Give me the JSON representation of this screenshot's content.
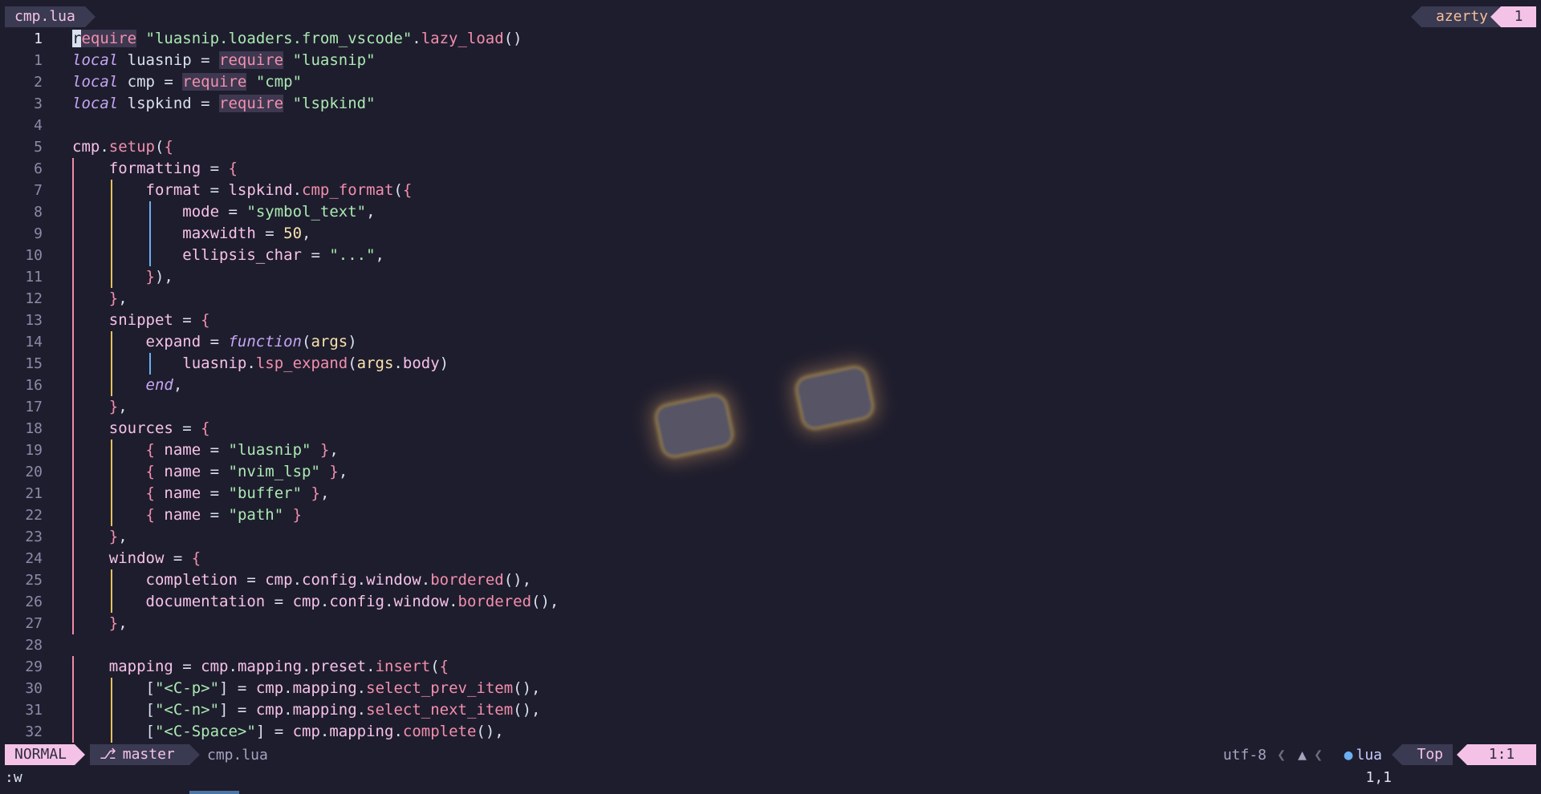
{
  "tabline": {
    "file": "cmp.lua",
    "keyboard_layout": "azerty",
    "tab_count": "1"
  },
  "editor": {
    "lines": [
      {
        "n": "1",
        "guides": 0,
        "current": true,
        "segs": [
          [
            "cursor",
            "r"
          ],
          [
            "req",
            "equire"
          ],
          [
            "op",
            " "
          ],
          [
            "str",
            "\"luasnip.loaders.from_vscode\""
          ],
          [
            "op",
            "."
          ],
          [
            "fn",
            "lazy_load"
          ],
          [
            "op",
            "()"
          ]
        ]
      },
      {
        "n": "1",
        "guides": 0,
        "segs": [
          [
            "kw",
            "local"
          ],
          [
            "id",
            " luasnip = "
          ],
          [
            "req",
            "require"
          ],
          [
            "op",
            " "
          ],
          [
            "str",
            "\"luasnip\""
          ]
        ]
      },
      {
        "n": "2",
        "guides": 0,
        "segs": [
          [
            "kw",
            "local"
          ],
          [
            "id",
            " cmp = "
          ],
          [
            "req",
            "require"
          ],
          [
            "op",
            " "
          ],
          [
            "str",
            "\"cmp\""
          ]
        ]
      },
      {
        "n": "3",
        "guides": 0,
        "segs": [
          [
            "kw",
            "local"
          ],
          [
            "id",
            " lspkind = "
          ],
          [
            "req",
            "require"
          ],
          [
            "op",
            " "
          ],
          [
            "str",
            "\"lspkind\""
          ]
        ]
      },
      {
        "n": "4",
        "guides": 0,
        "segs": []
      },
      {
        "n": "5",
        "guides": 0,
        "segs": [
          [
            "fld",
            "cmp"
          ],
          [
            "op",
            "."
          ],
          [
            "fn",
            "setup"
          ],
          [
            "op",
            "("
          ],
          [
            "br1",
            "{"
          ]
        ]
      },
      {
        "n": "6",
        "guides": 1,
        "segs": [
          [
            "id",
            "    "
          ],
          [
            "fld",
            "formatting"
          ],
          [
            "op",
            " = "
          ],
          [
            "br1",
            "{"
          ]
        ]
      },
      {
        "n": "7",
        "guides": 2,
        "segs": [
          [
            "id",
            "        "
          ],
          [
            "fld",
            "format"
          ],
          [
            "op",
            " = "
          ],
          [
            "fld",
            "lspkind"
          ],
          [
            "op",
            "."
          ],
          [
            "fn",
            "cmp_format"
          ],
          [
            "op",
            "("
          ],
          [
            "br1",
            "{"
          ]
        ]
      },
      {
        "n": "8",
        "guides": 3,
        "segs": [
          [
            "id",
            "            "
          ],
          [
            "fld",
            "mode"
          ],
          [
            "op",
            " = "
          ],
          [
            "str",
            "\"symbol_text\""
          ],
          [
            "op",
            ","
          ]
        ]
      },
      {
        "n": "9",
        "guides": 3,
        "segs": [
          [
            "id",
            "            "
          ],
          [
            "fld",
            "maxwidth"
          ],
          [
            "op",
            " = "
          ],
          [
            "num",
            "50"
          ],
          [
            "op",
            ","
          ]
        ]
      },
      {
        "n": "10",
        "guides": 3,
        "segs": [
          [
            "id",
            "            "
          ],
          [
            "fld",
            "ellipsis_char"
          ],
          [
            "op",
            " = "
          ],
          [
            "str",
            "\"...\""
          ],
          [
            "op",
            ","
          ]
        ]
      },
      {
        "n": "11",
        "guides": 2,
        "segs": [
          [
            "id",
            "        "
          ],
          [
            "br1",
            "}"
          ],
          [
            "op",
            "),"
          ]
        ]
      },
      {
        "n": "12",
        "guides": 1,
        "segs": [
          [
            "id",
            "    "
          ],
          [
            "br1",
            "}"
          ],
          [
            "op",
            ","
          ]
        ]
      },
      {
        "n": "13",
        "guides": 1,
        "segs": [
          [
            "id",
            "    "
          ],
          [
            "fld",
            "snippet"
          ],
          [
            "op",
            " = "
          ],
          [
            "br1",
            "{"
          ]
        ]
      },
      {
        "n": "14",
        "guides": 2,
        "segs": [
          [
            "id",
            "        "
          ],
          [
            "fld",
            "expand"
          ],
          [
            "op",
            " = "
          ],
          [
            "kw",
            "function"
          ],
          [
            "op",
            "("
          ],
          [
            "arg",
            "args"
          ],
          [
            "op",
            ")"
          ]
        ]
      },
      {
        "n": "15",
        "guides": 3,
        "segs": [
          [
            "id",
            "            "
          ],
          [
            "fld",
            "luasnip"
          ],
          [
            "op",
            "."
          ],
          [
            "fn",
            "lsp_expand"
          ],
          [
            "op",
            "("
          ],
          [
            "arg",
            "args"
          ],
          [
            "op",
            "."
          ],
          [
            "fld",
            "body"
          ],
          [
            "op",
            ")"
          ]
        ]
      },
      {
        "n": "16",
        "guides": 2,
        "segs": [
          [
            "id",
            "        "
          ],
          [
            "kw",
            "end"
          ],
          [
            "op",
            ","
          ]
        ]
      },
      {
        "n": "17",
        "guides": 1,
        "segs": [
          [
            "id",
            "    "
          ],
          [
            "br1",
            "}"
          ],
          [
            "op",
            ","
          ]
        ]
      },
      {
        "n": "18",
        "guides": 1,
        "segs": [
          [
            "id",
            "    "
          ],
          [
            "fld",
            "sources"
          ],
          [
            "op",
            " = "
          ],
          [
            "br1",
            "{"
          ]
        ]
      },
      {
        "n": "19",
        "guides": 2,
        "segs": [
          [
            "id",
            "        "
          ],
          [
            "br1",
            "{"
          ],
          [
            "op",
            " "
          ],
          [
            "fld",
            "name"
          ],
          [
            "op",
            " = "
          ],
          [
            "str",
            "\"luasnip\""
          ],
          [
            "op",
            " "
          ],
          [
            "br1",
            "}"
          ],
          [
            "op",
            ","
          ]
        ]
      },
      {
        "n": "20",
        "guides": 2,
        "segs": [
          [
            "id",
            "        "
          ],
          [
            "br1",
            "{"
          ],
          [
            "op",
            " "
          ],
          [
            "fld",
            "name"
          ],
          [
            "op",
            " = "
          ],
          [
            "str",
            "\"nvim_lsp\""
          ],
          [
            "op",
            " "
          ],
          [
            "br1",
            "}"
          ],
          [
            "op",
            ","
          ]
        ]
      },
      {
        "n": "21",
        "guides": 2,
        "segs": [
          [
            "id",
            "        "
          ],
          [
            "br1",
            "{"
          ],
          [
            "op",
            " "
          ],
          [
            "fld",
            "name"
          ],
          [
            "op",
            " = "
          ],
          [
            "str",
            "\"buffer\""
          ],
          [
            "op",
            " "
          ],
          [
            "br1",
            "}"
          ],
          [
            "op",
            ","
          ]
        ]
      },
      {
        "n": "22",
        "guides": 2,
        "segs": [
          [
            "id",
            "        "
          ],
          [
            "br1",
            "{"
          ],
          [
            "op",
            " "
          ],
          [
            "fld",
            "name"
          ],
          [
            "op",
            " = "
          ],
          [
            "str",
            "\"path\""
          ],
          [
            "op",
            " "
          ],
          [
            "br1",
            "}"
          ]
        ]
      },
      {
        "n": "23",
        "guides": 1,
        "segs": [
          [
            "id",
            "    "
          ],
          [
            "br1",
            "}"
          ],
          [
            "op",
            ","
          ]
        ]
      },
      {
        "n": "24",
        "guides": 1,
        "segs": [
          [
            "id",
            "    "
          ],
          [
            "fld",
            "window"
          ],
          [
            "op",
            " = "
          ],
          [
            "br1",
            "{"
          ]
        ]
      },
      {
        "n": "25",
        "guides": 2,
        "segs": [
          [
            "id",
            "        "
          ],
          [
            "fld",
            "completion"
          ],
          [
            "op",
            " = "
          ],
          [
            "fld",
            "cmp"
          ],
          [
            "op",
            "."
          ],
          [
            "fld",
            "config"
          ],
          [
            "op",
            "."
          ],
          [
            "fld",
            "window"
          ],
          [
            "op",
            "."
          ],
          [
            "fn",
            "bordered"
          ],
          [
            "op",
            "(),"
          ]
        ]
      },
      {
        "n": "26",
        "guides": 2,
        "segs": [
          [
            "id",
            "        "
          ],
          [
            "fld",
            "documentation"
          ],
          [
            "op",
            " = "
          ],
          [
            "fld",
            "cmp"
          ],
          [
            "op",
            "."
          ],
          [
            "fld",
            "config"
          ],
          [
            "op",
            "."
          ],
          [
            "fld",
            "window"
          ],
          [
            "op",
            "."
          ],
          [
            "fn",
            "bordered"
          ],
          [
            "op",
            "(),"
          ]
        ]
      },
      {
        "n": "27",
        "guides": 1,
        "segs": [
          [
            "id",
            "    "
          ],
          [
            "br1",
            "}"
          ],
          [
            "op",
            ","
          ]
        ]
      },
      {
        "n": "28",
        "guides": 0,
        "segs": []
      },
      {
        "n": "29",
        "guides": 1,
        "segs": [
          [
            "id",
            "    "
          ],
          [
            "fld",
            "mapping"
          ],
          [
            "op",
            " = "
          ],
          [
            "fld",
            "cmp"
          ],
          [
            "op",
            "."
          ],
          [
            "fld",
            "mapping"
          ],
          [
            "op",
            "."
          ],
          [
            "fld",
            "preset"
          ],
          [
            "op",
            "."
          ],
          [
            "fn",
            "insert"
          ],
          [
            "op",
            "("
          ],
          [
            "br1",
            "{"
          ]
        ]
      },
      {
        "n": "30",
        "guides": 2,
        "segs": [
          [
            "id",
            "        "
          ],
          [
            "op",
            "["
          ],
          [
            "str",
            "\"<C-p>\""
          ],
          [
            "op",
            "] = "
          ],
          [
            "fld",
            "cmp"
          ],
          [
            "op",
            "."
          ],
          [
            "fld",
            "mapping"
          ],
          [
            "op",
            "."
          ],
          [
            "fn",
            "select_prev_item"
          ],
          [
            "op",
            "(),"
          ]
        ]
      },
      {
        "n": "31",
        "guides": 2,
        "segs": [
          [
            "id",
            "        "
          ],
          [
            "op",
            "["
          ],
          [
            "str",
            "\"<C-n>\""
          ],
          [
            "op",
            "] = "
          ],
          [
            "fld",
            "cmp"
          ],
          [
            "op",
            "."
          ],
          [
            "fld",
            "mapping"
          ],
          [
            "op",
            "."
          ],
          [
            "fn",
            "select_next_item"
          ],
          [
            "op",
            "(),"
          ]
        ]
      },
      {
        "n": "32",
        "guides": 2,
        "segs": [
          [
            "id",
            "        "
          ],
          [
            "op",
            "["
          ],
          [
            "str",
            "\"<C-Space>\""
          ],
          [
            "op",
            "] = "
          ],
          [
            "fld",
            "cmp"
          ],
          [
            "op",
            "."
          ],
          [
            "fld",
            "mapping"
          ],
          [
            "op",
            "."
          ],
          [
            "fn",
            "complete"
          ],
          [
            "op",
            "(),"
          ]
        ]
      }
    ]
  },
  "statusline": {
    "mode": "NORMAL",
    "branch_icon": "git-branch-icon",
    "branch": "master",
    "file": "cmp.lua",
    "encoding": "utf-8",
    "os_icon": "penguin-icon",
    "filetype_icon": "lua-icon",
    "filetype": "lua",
    "scroll": "Top",
    "line_col": "1:1"
  },
  "cmdline": {
    "command": ":w",
    "ruler": "1,1"
  }
}
